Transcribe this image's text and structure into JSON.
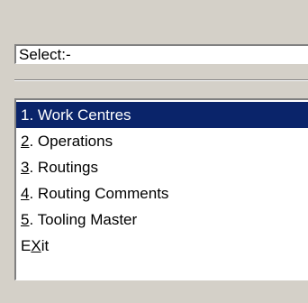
{
  "select_label": "Select:-",
  "menu": {
    "items": [
      {
        "num": "1",
        "text": ". Work Centres",
        "selected": true
      },
      {
        "num": "2",
        "text": ". Operations"
      },
      {
        "num": "3",
        "text": ". Routings"
      },
      {
        "num": "4",
        "text": ". Routing Comments"
      },
      {
        "num": "5",
        "text": ". Tooling Master"
      },
      {
        "prefix": "E",
        "hotkey": "X",
        "suffix": "it"
      }
    ]
  },
  "colors": {
    "background": "#d4d0c8",
    "selection_bg": "#0a246a",
    "selection_text": "#ffffff"
  }
}
